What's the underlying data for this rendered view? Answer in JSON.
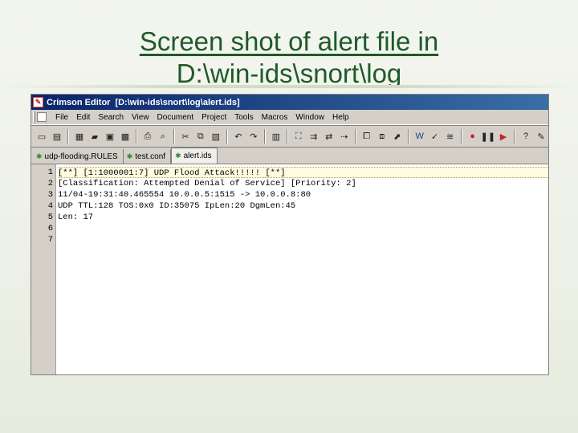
{
  "slide": {
    "title_line1": "Screen shot of alert file in",
    "title_line2": "D:\\win-ids\\snort\\log"
  },
  "window": {
    "app_name": "Crimson Editor",
    "file_path": "[D:\\win-ids\\snort\\log\\alert.ids]"
  },
  "menu": {
    "items": [
      "File",
      "Edit",
      "Search",
      "View",
      "Document",
      "Project",
      "Tools",
      "Macros",
      "Window",
      "Help"
    ]
  },
  "toolbar": {
    "buttons": [
      {
        "icon": "new-file-icon",
        "glyph": "▭"
      },
      {
        "icon": "new-template-icon",
        "glyph": "▤"
      },
      {
        "icon": "open-file-icon",
        "glyph": "▦"
      },
      {
        "icon": "open-folder-icon",
        "glyph": "▰"
      },
      {
        "icon": "save-icon",
        "glyph": "▣"
      },
      {
        "icon": "save-all-icon",
        "glyph": "▩"
      },
      {
        "icon": "print-icon",
        "glyph": "⎙"
      },
      {
        "icon": "print-preview-icon",
        "glyph": "⌕"
      },
      {
        "icon": "cut-icon",
        "glyph": "✂"
      },
      {
        "icon": "copy-icon",
        "glyph": "⧉"
      },
      {
        "icon": "paste-icon",
        "glyph": "▧"
      },
      {
        "icon": "undo-icon",
        "glyph": "↶"
      },
      {
        "icon": "redo-icon",
        "glyph": "↷"
      },
      {
        "icon": "column-mode-icon",
        "glyph": "▥"
      },
      {
        "icon": "find-icon",
        "glyph": "⛶"
      },
      {
        "icon": "find-next-icon",
        "glyph": "⇉"
      },
      {
        "icon": "replace-icon",
        "glyph": "⇄"
      },
      {
        "icon": "goto-icon",
        "glyph": "⇢"
      },
      {
        "icon": "window-list-icon",
        "glyph": "⧠"
      },
      {
        "icon": "tile-icon",
        "glyph": "⧈"
      },
      {
        "icon": "browse-icon",
        "glyph": "⬈"
      },
      {
        "icon": "word-wrap-icon",
        "glyph": "W"
      },
      {
        "icon": "spell-check-icon",
        "glyph": "✓"
      },
      {
        "icon": "settings-icon",
        "glyph": "≋"
      },
      {
        "icon": "record-macro-icon",
        "glyph": "●"
      },
      {
        "icon": "pause-macro-icon",
        "glyph": "❚❚"
      },
      {
        "icon": "play-macro-icon",
        "glyph": "▶"
      },
      {
        "icon": "help-icon",
        "glyph": "?"
      },
      {
        "icon": "about-icon",
        "glyph": "✎"
      }
    ],
    "separators_after": [
      1,
      5,
      7,
      10,
      12,
      13,
      17,
      20,
      23,
      26
    ]
  },
  "tabs": [
    {
      "label": "udp-flooding.RULES",
      "active": false
    },
    {
      "label": "test.conf",
      "active": false
    },
    {
      "label": "alert.ids",
      "active": true
    }
  ],
  "editor": {
    "line_numbers": [
      "1",
      "2",
      "3",
      "4",
      "5",
      "6",
      "7"
    ],
    "current_line": 0,
    "lines": [
      "[**] [1:1000001:7] UDP Flood Attack!!!!! [**]",
      "[Classification: Attempted Denial of Service] [Priority: 2]",
      "11/04-19:31:40.465554 10.0.0.5:1515 -> 10.0.0.8:80",
      "UDP TTL:128 TOS:0x0 ID:35075 IpLen:20 DgmLen:45",
      "Len: 17",
      "",
      ""
    ]
  },
  "colors": {
    "title_text": "#1f5a2a",
    "titlebar_start": "#0a246a",
    "titlebar_end": "#3a6ea5",
    "window_face": "#d4d0c8",
    "editor_bg": "#ffffff",
    "current_line_bg": "#fffbe0"
  }
}
